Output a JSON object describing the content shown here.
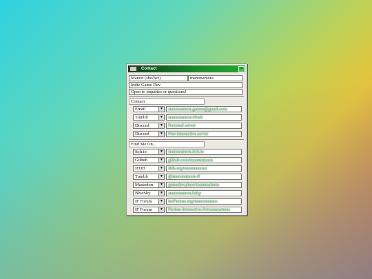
{
  "window": {
    "title": "Contact"
  },
  "profile": {
    "name": "Manon (she/her)",
    "handle": "manonamora",
    "role": "Indie Game Dev",
    "status": "Open to inquiries or questions!"
  },
  "contact": {
    "label": "Contact",
    "rows": [
      {
        "type": "Email",
        "value": "manonamora.games@gmail.com"
      },
      {
        "type": "Tumblr",
        "value": "manonamora-if/ask"
      },
      {
        "type": "Discord",
        "value": "Personal server"
      },
      {
        "type": "Discord",
        "value": "Neo-Interactive server"
      }
    ]
  },
  "findme": {
    "label": "Find Me On...",
    "rows": [
      {
        "type": "Itch.io",
        "value": "manonamora.itch.io"
      },
      {
        "type": "Github",
        "value": "github.com/manonamora"
      },
      {
        "type": "IFDB",
        "value": "ifdb.org/manonamora"
      },
      {
        "type": "Tumblr",
        "value": "@manonamora-if"
      },
      {
        "type": "Mastodon",
        "value": "gamedev.place/manonamora"
      },
      {
        "type": "BlueSky",
        "value": "manonamora.bsky"
      },
      {
        "type": "IF Forum",
        "value": "IntFiction.org/manonamora"
      },
      {
        "type": "IF Forum",
        "value": "Fiction-Interactive.fr/manonamora"
      }
    ]
  },
  "icons": {
    "window": "window-icon",
    "close": "close-icon",
    "dropdown": "chevron-down-icon"
  },
  "colors": {
    "titlebar": "#1a8a2a",
    "link_outline": "#1f7a2a"
  }
}
